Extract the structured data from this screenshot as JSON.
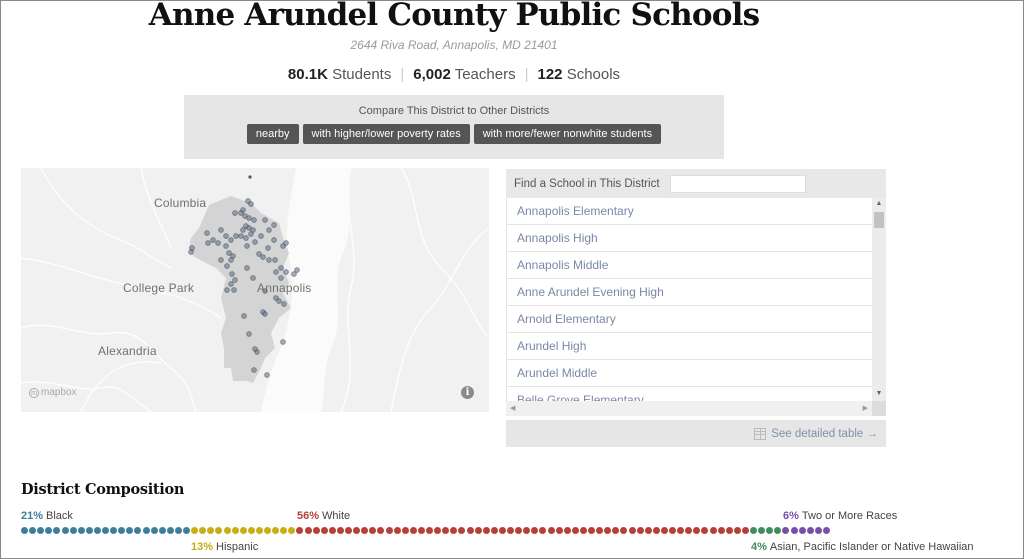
{
  "header": {
    "title": "Anne Arundel County Public Schools",
    "address": "2644 Riva Road, Annapolis, MD 21401",
    "stats": [
      {
        "value": "80.1K",
        "label": "Students"
      },
      {
        "value": "6,002",
        "label": "Teachers"
      },
      {
        "value": "122",
        "label": "Schools"
      }
    ],
    "separator": "|"
  },
  "compare": {
    "label": "Compare This District to Other Districts",
    "buttons": [
      "nearby",
      "with higher/lower poverty rates",
      "with more/fewer nonwhite students"
    ]
  },
  "map": {
    "cities": [
      "Columbia",
      "College Park",
      "Annapolis",
      "Alexandria"
    ],
    "attribution": "mapbox",
    "info_icon": "info-icon"
  },
  "finder": {
    "label": "Find a School in This District",
    "search_value": "",
    "schools": [
      "Annapolis Elementary",
      "Annapolis High",
      "Annapolis Middle",
      "Anne Arundel Evening High",
      "Arnold Elementary",
      "Arundel High",
      "Arundel Middle",
      "Belle Grove Elementary"
    ],
    "detail_link": "See detailed table →"
  },
  "composition": {
    "title": "District Composition",
    "groups": [
      {
        "name": "Black",
        "pct": 21,
        "pct_label": "21%",
        "color": "#3d7e9a"
      },
      {
        "name": "Hispanic",
        "pct": 13,
        "pct_label": "13%",
        "color": "#c9ab14"
      },
      {
        "name": "White",
        "pct": 56,
        "pct_label": "56%",
        "color": "#b5403a"
      },
      {
        "name": "Asian, Pacific Islander or Native Hawaiian",
        "pct": 4,
        "pct_label": "4%",
        "color": "#3f8c5e"
      },
      {
        "name": "Two or More Races",
        "pct": 6,
        "pct_label": "6%",
        "color": "#7a4fa8"
      }
    ]
  }
}
